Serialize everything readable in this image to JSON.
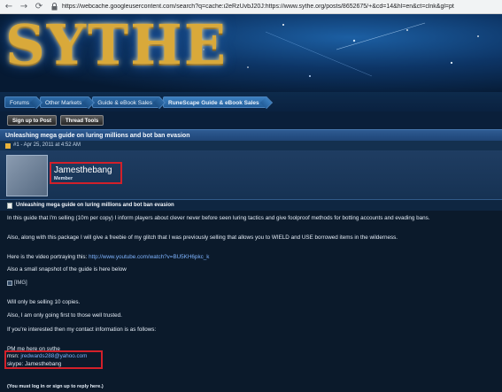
{
  "browser": {
    "url": "https://webcache.googleusercontent.com/search?q=cache:i2eRzUvbJ20J:https://www.sythe.org/posts/8652675/+&cd=14&hl=en&ct=clnk&gl=pt"
  },
  "site": {
    "logo_text": "SYTHE"
  },
  "breadcrumb": [
    "Forums",
    "Other Markets",
    "Guide & eBook Sales",
    "RuneScape Guide & eBook Sales"
  ],
  "toolbar": {
    "sign_up_label": "Sign up to Post",
    "thread_tools_label": "Thread Tools"
  },
  "thread": {
    "title": "Unleashing mega guide on luring millions and bot ban evasion"
  },
  "post": {
    "meta": "#1 - Apr 25, 2011 at 4:52 AM",
    "username": "Jamesthebang",
    "user_title": "Member",
    "title": "Unleashing mega guide on luring millions and bot ban evasion",
    "p1": "In this guide that I'm selling (10m per copy) I inform players about clever never before seen luring tactics and give foolproof methods for botting accounts and evading bans.",
    "p2": "Also, along with this package I will give a freebie of my glitch that I was previously selling that allows you to WIELD and USE borrowed items in the wilderness.",
    "video_label": "Here is the video portraying this: ",
    "video_link": "http://www.youtube.com/watch?v=BU5KH6pkc_k",
    "snapshot": "Also a small snapshot of the guide is here below",
    "img_tag": "[IMG]",
    "copies": "Will only be selling 10 copies.",
    "trusted": "Also, I am only going first to those well trusted.",
    "contact_intro": "If you're interested then my contact information is as follows:",
    "pm": "PM me here on sythe",
    "msn_label": "msn: ",
    "msn_value": "jredwards288@yahoo.com",
    "skype": "skype: Jamesthebang",
    "reply_note": "(You must log in or sign up to reply here.)"
  },
  "colors": {
    "highlight_box": "#d2202a",
    "link": "#7fb4ff",
    "title_bar": "#2e5b92"
  }
}
